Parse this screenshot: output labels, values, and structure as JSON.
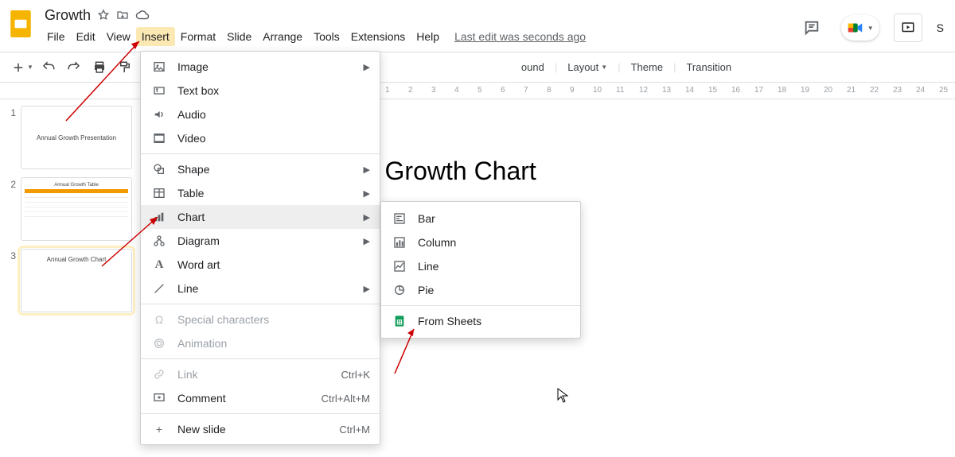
{
  "doc": {
    "title": "Growth"
  },
  "menubar": {
    "items": [
      "File",
      "Edit",
      "View",
      "Insert",
      "Format",
      "Slide",
      "Arrange",
      "Tools",
      "Extensions",
      "Help"
    ],
    "last_edit": "Last edit was seconds ago"
  },
  "toolbar_right": {
    "background_visible_fragment": "ound",
    "layout": "Layout",
    "theme": "Theme",
    "transition": "Transition"
  },
  "ruler": {
    "ticks": [
      1,
      2,
      3,
      4,
      5,
      6,
      7,
      8,
      9,
      10,
      11,
      12,
      13,
      14,
      15,
      16,
      17,
      18,
      19,
      20,
      21,
      22,
      23,
      24,
      25
    ]
  },
  "thumbnails": [
    {
      "n": "1",
      "title": "Annual Growth Presentation"
    },
    {
      "n": "2",
      "title": "Annual Growth Table"
    },
    {
      "n": "3",
      "title": "Annual Growth Chart"
    }
  ],
  "slide": {
    "title": "Annual Growth Chart"
  },
  "insert_menu": {
    "image": "Image",
    "textbox": "Text box",
    "audio": "Audio",
    "video": "Video",
    "shape": "Shape",
    "table": "Table",
    "chart": "Chart",
    "diagram": "Diagram",
    "wordart": "Word art",
    "line": "Line",
    "special_chars": "Special characters",
    "animation": "Animation",
    "link": "Link",
    "link_short": "Ctrl+K",
    "comment": "Comment",
    "comment_short": "Ctrl+Alt+M",
    "newslide": "New slide",
    "newslide_short": "Ctrl+M"
  },
  "chart_submenu": {
    "bar": "Bar",
    "column": "Column",
    "line": "Line",
    "pie": "Pie",
    "from_sheets": "From Sheets"
  },
  "share_letter": "S"
}
